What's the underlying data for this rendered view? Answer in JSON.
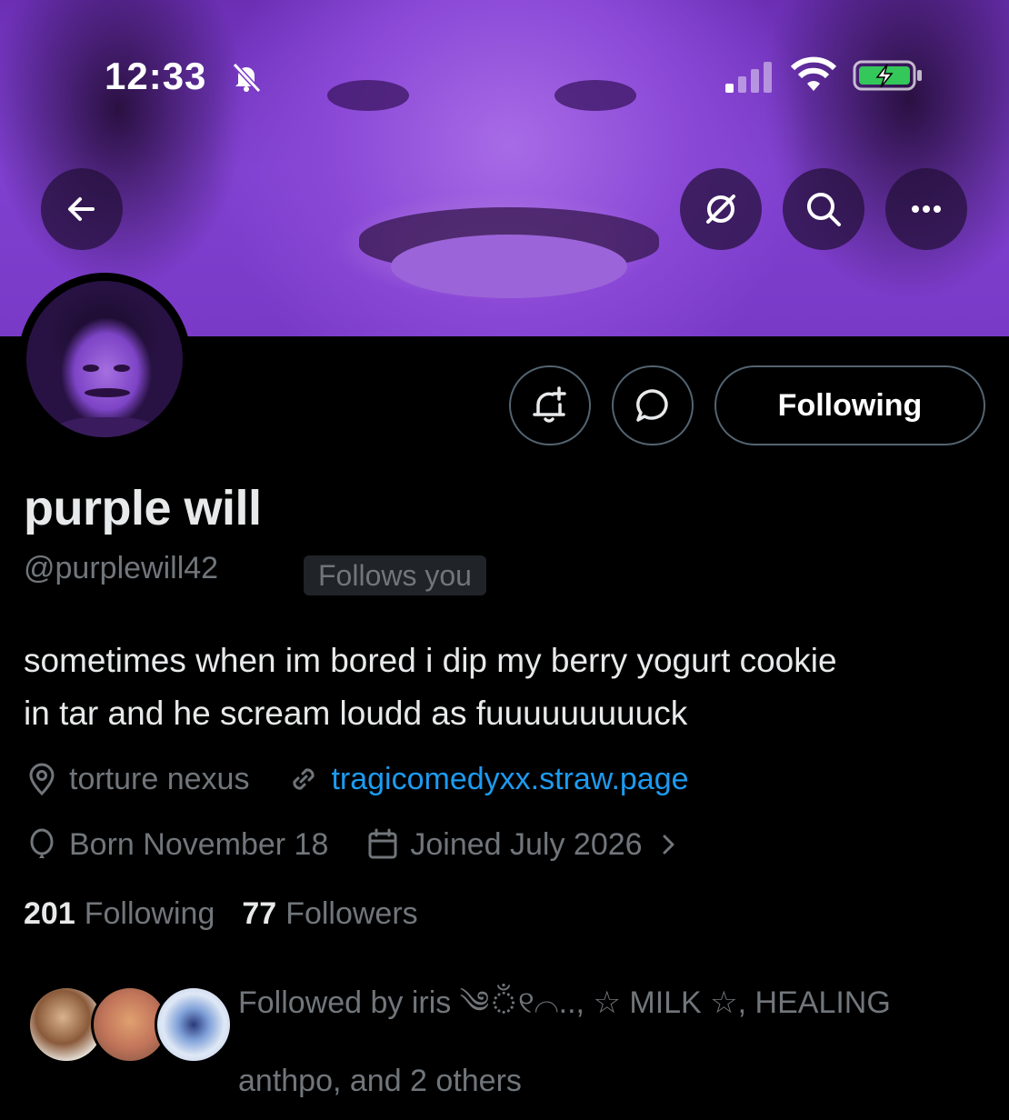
{
  "status_bar": {
    "time": "12:33"
  },
  "profile": {
    "display_name": "purple will",
    "handle": "@purplewill42",
    "follows_you_badge": "Follows you",
    "bio_line1": "sometimes when im bored i dip my berry yogurt cookie",
    "bio_line2": "in tar and he scream loudd as fuuuuuuuuuck",
    "location": "torture nexus",
    "website": "tragicomedyxx.straw.page",
    "birthday": "Born November 18",
    "joined": "Joined July 2026",
    "following_count": "201",
    "following_label": "Following",
    "followers_count": "77",
    "followers_label": "Followers"
  },
  "actions": {
    "following_button": "Following"
  },
  "followed_by": {
    "line1": "Followed by iris ༄ঁ୧⌒.., ☆ MILK ☆, HEALING",
    "line2": "anthpo, and 2 others"
  },
  "icons": {
    "back": "arrow-left-icon",
    "grok": "grok-icon",
    "search": "search-icon",
    "more": "more-icon",
    "notify": "bell-plus-icon",
    "message": "message-bubble-icon",
    "location": "location-pin-icon",
    "link": "link-icon",
    "birthday": "balloon-icon",
    "calendar": "calendar-icon",
    "chevron": "chevron-right-icon"
  },
  "colors": {
    "accent": "#1d9bf0",
    "muted": "#71767b",
    "banner": "#8a48d6"
  }
}
